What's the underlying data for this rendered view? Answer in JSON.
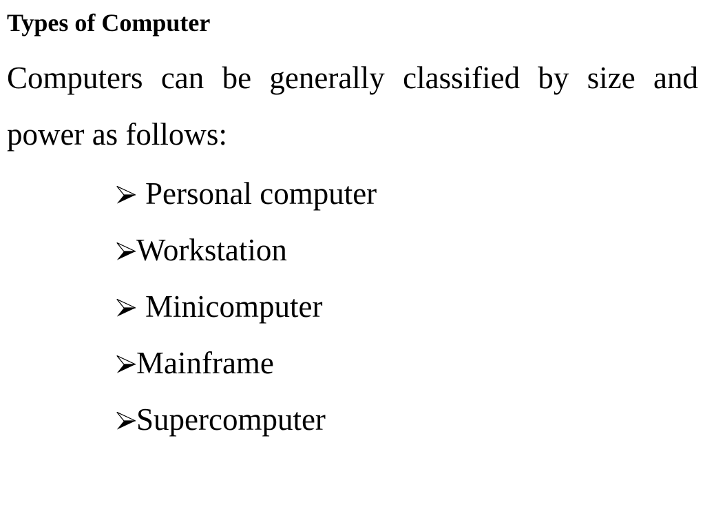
{
  "slide": {
    "background_color": "#ffffff",
    "text_color": "#000000",
    "title": "Types of Computer",
    "paragraph": {
      "line1": "Computers can be generally classified by size and",
      "line2": "power as follows:",
      "full_text": "Computers can be generally classified by size and power as follows:"
    },
    "bullet_symbol": "➢",
    "bullets": [
      {
        "label": "Personal computer",
        "leading_space": true
      },
      {
        "label": "Workstation",
        "leading_space": false
      },
      {
        "label": "Minicomputer",
        "leading_space": true
      },
      {
        "label": "Mainframe",
        "leading_space": false
      },
      {
        "label": "Supercomputer",
        "leading_space": false
      }
    ]
  }
}
